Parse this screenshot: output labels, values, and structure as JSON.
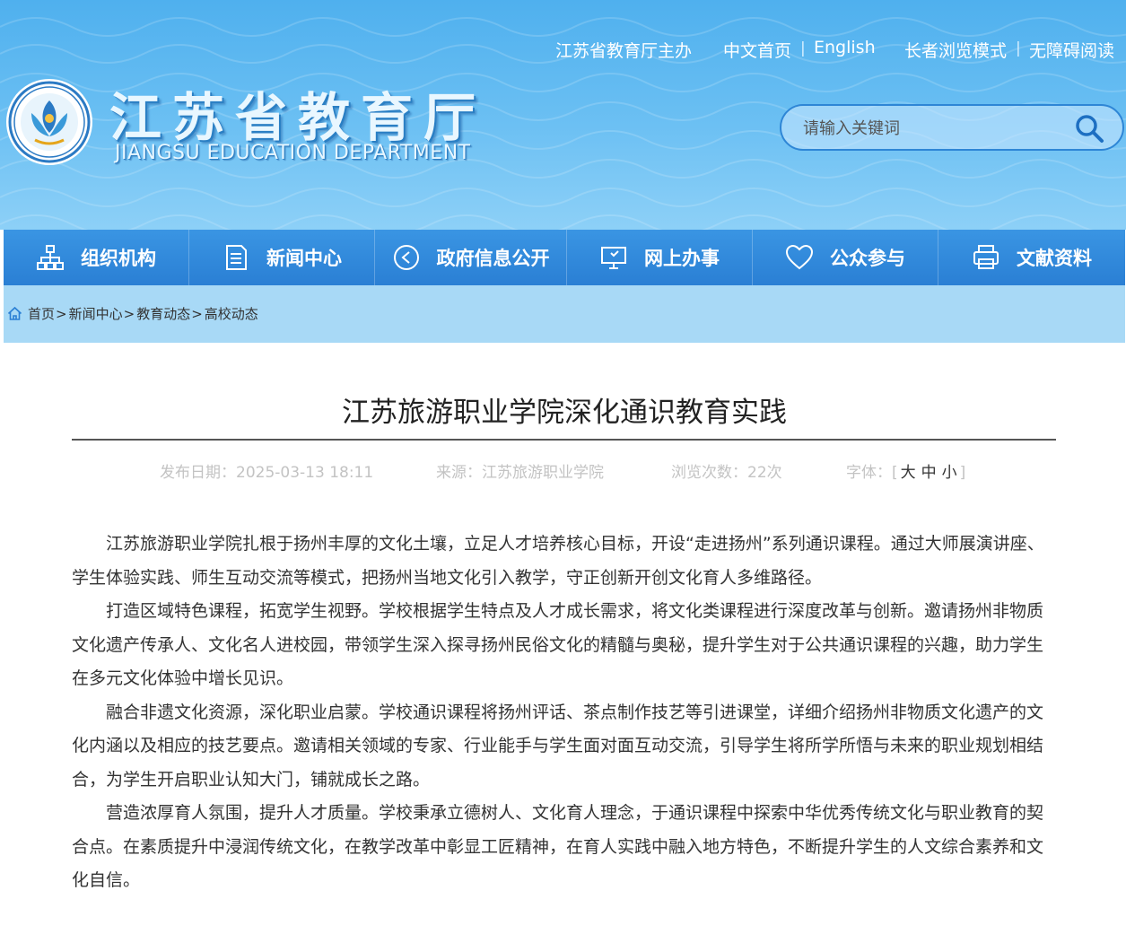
{
  "header": {
    "top_links": {
      "host": "江苏省教育厅主办",
      "home": "中文首页",
      "english": "English",
      "elder_mode": "长者浏览模式",
      "accessible": "无障碍阅读",
      "separator": "|"
    },
    "logo": {
      "name_cn": "江苏省教育厅",
      "name_en": "JIANGSU EDUCATION DEPARTMENT"
    },
    "search": {
      "placeholder": "请输入关键词",
      "icon": "search-icon"
    }
  },
  "nav": {
    "items": [
      {
        "label": "组织机构",
        "icon": "org-chart-icon"
      },
      {
        "label": "新闻中心",
        "icon": "document-icon"
      },
      {
        "label": "政府信息公开",
        "icon": "play-circle-icon"
      },
      {
        "label": "网上办事",
        "icon": "monitor-icon"
      },
      {
        "label": "公众参与",
        "icon": "heart-icon"
      },
      {
        "label": "文献资料",
        "icon": "printer-icon"
      }
    ]
  },
  "breadcrumb": {
    "items": [
      "首页",
      "新闻中心",
      "教育动态",
      "高校动态"
    ],
    "separator": ">"
  },
  "article": {
    "title": "江苏旅游职业学院深化通识教育实践",
    "meta": {
      "date_label": "发布日期：",
      "date": "2025-03-13 18:11",
      "source_label": "来源：",
      "source": "江苏旅游职业学院",
      "views_label": "浏览次数：",
      "views": "22次",
      "font_label": "字体：",
      "bracket_open": "[",
      "bracket_close": "]",
      "font_sizes": [
        "大",
        "中",
        "小"
      ]
    },
    "paragraphs": [
      "江苏旅游职业学院扎根于扬州丰厚的文化土壤，立足人才培养核心目标，开设“走进扬州”系列通识课程。通过大师展演讲座、学生体验实践、师生互动交流等模式，把扬州当地文化引入教学，守正创新开创文化育人多维路径。",
      "打造区域特色课程，拓宽学生视野。学校根据学生特点及人才成长需求，将文化类课程进行深度改革与创新。邀请扬州非物质文化遗产传承人、文化名人进校园，带领学生深入探寻扬州民俗文化的精髓与奥秘，提升学生对于公共通识课程的兴趣，助力学生在多元文化体验中增长见识。",
      "融合非遗文化资源，深化职业启蒙。学校通识课程将扬州评话、茶点制作技艺等引进课堂，详细介绍扬州非物质文化遗产的文化内涵以及相应的技艺要点。邀请相关领域的专家、行业能手与学生面对面互动交流，引导学生将所学所悟与未来的职业规划相结合，为学生开启职业认知大门，铺就成长之路。",
      "营造浓厚育人氛围，提升人才质量。学校秉承立德树人、文化育人理念，于通识课程中探索中华优秀传统文化与职业教育的契合点。在素质提升中浸润传统文化，在教学改革中彰显工匠精神，在育人实践中融入地方特色，不断提升学生的人文综合素养和文化自信。"
    ]
  },
  "colors": {
    "header_blue": "#4fb0ee",
    "nav_blue": "#2a7fd4",
    "crumb_band": "#a8d9f6",
    "meta_gray": "#c3c3c3"
  }
}
